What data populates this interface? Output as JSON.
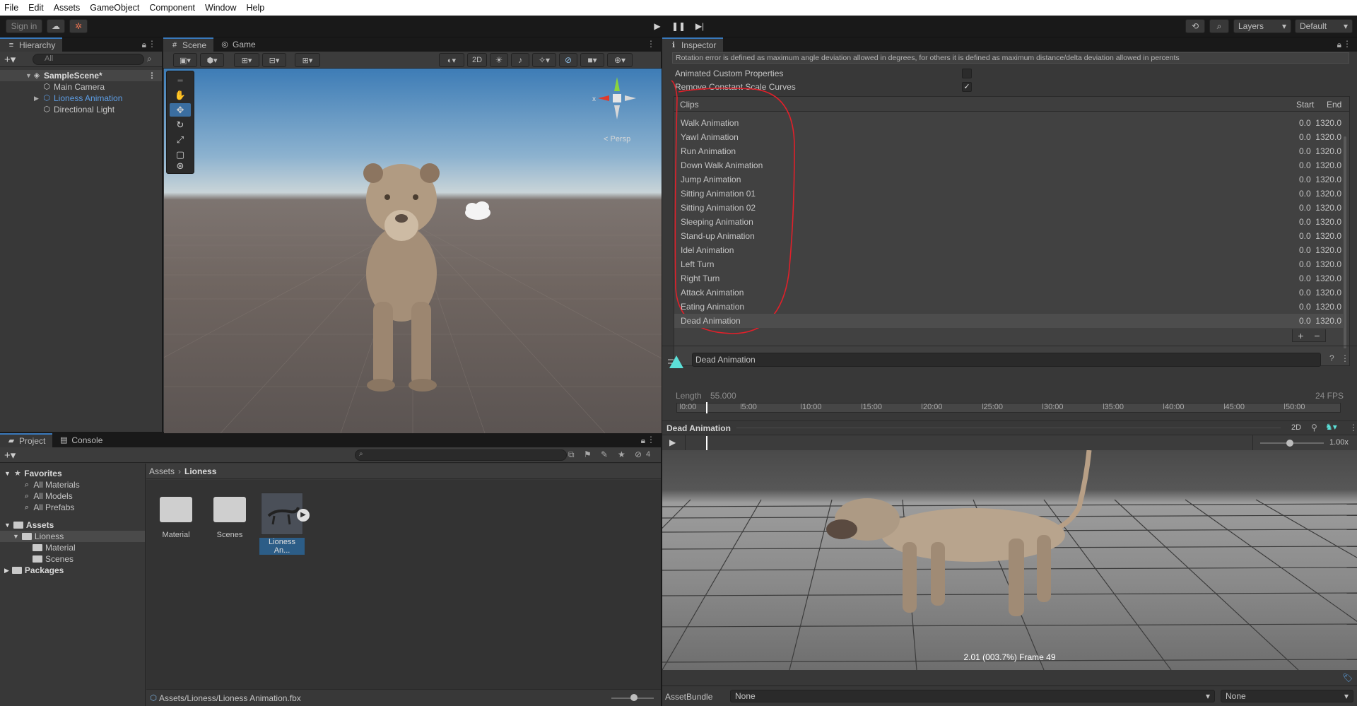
{
  "menu": [
    "File",
    "Edit",
    "Assets",
    "GameObject",
    "Component",
    "Window",
    "Help"
  ],
  "toolbar": {
    "sign_in": "Sign in",
    "layers": "Layers",
    "layout": "Default"
  },
  "hierarchy": {
    "tab": "Hierarchy",
    "search_placeholder": "All",
    "scene": "SampleScene*",
    "items": [
      "Main Camera",
      "Lioness Animation",
      "Directional Light"
    ]
  },
  "scene_panel": {
    "tabs": [
      "Scene",
      "Game"
    ],
    "mode_2d": "2D",
    "persp": "< Persp",
    "gizmo_x": "x"
  },
  "inspector": {
    "tab": "Inspector",
    "hint": "Rotation error is defined as maximum angle deviation allowed in degrees, for others it is defined as maximum distance/delta deviation allowed in percents",
    "prop1": "Animated Custom Properties",
    "prop2": "Remove Constant Scale Curves",
    "clips_header": "Clips",
    "col_start": "Start",
    "col_end": "End",
    "clips": [
      {
        "name": "Walk Animation",
        "values": "0.0  1320.0"
      },
      {
        "name": "YawI Animation",
        "values": "0.0  1320.0"
      },
      {
        "name": "Run Animation",
        "values": "0.0  1320.0"
      },
      {
        "name": "Down Walk Animation",
        "values": "0.0  1320.0"
      },
      {
        "name": "Jump Animation",
        "values": "0.0  1320.0"
      },
      {
        "name": "Sitting Animation 01",
        "values": "0.0  1320.0"
      },
      {
        "name": "Sitting Animation 02",
        "values": "0.0  1320.0"
      },
      {
        "name": "Sleeping Animation",
        "values": "0.0  1320.0"
      },
      {
        "name": "Stand-up Animation",
        "values": "0.0  1320.0"
      },
      {
        "name": "Idel Animation",
        "values": "0.0  1320.0"
      },
      {
        "name": "Left Turn",
        "values": "0.0  1320.0"
      },
      {
        "name": "Right Turn",
        "values": "0.0  1320.0"
      },
      {
        "name": "Attack Animation",
        "values": "0.0  1320.0"
      },
      {
        "name": "Eating Animation",
        "values": "0.0  1320.0"
      },
      {
        "name": "Dead Animation",
        "values": "0.0  1320.0"
      }
    ],
    "plus": "+",
    "minus": "−",
    "clip_name": "Dead Animation",
    "length_label": "Length",
    "length_value": "55.000",
    "fps": "24 FPS",
    "ruler": [
      "0:00",
      "5:00",
      "10:00",
      "15:00",
      "20:00",
      "25:00",
      "30:00",
      "35:00",
      "40:00",
      "45:00",
      "50:00"
    ],
    "preview_title": "Dead Animation",
    "preview_2d": "2D",
    "speed": "1.00x",
    "frame_info": "2.01 (003.7%) Frame 49",
    "asset_bundle_label": "AssetBundle",
    "asset_bundle_value": "None",
    "variant_value": "None"
  },
  "project": {
    "tabs": [
      "Project",
      "Console"
    ],
    "favorites": "Favorites",
    "fav_items": [
      "All Materials",
      "All Models",
      "All Prefabs"
    ],
    "assets": "Assets",
    "tree": [
      "Lioness",
      "Material",
      "Scenes"
    ],
    "packages": "Packages",
    "breadcrumb": [
      "Assets",
      "Lioness"
    ],
    "grid": [
      "Material",
      "Scenes",
      "Lioness An..."
    ],
    "hidden_count": "4",
    "path": "Assets/Lioness/Lioness Animation.fbx"
  },
  "colors": {
    "accent": "#3a79bb",
    "selection": "#2c5d87",
    "link": "#4c8fd6",
    "annotation": "#e0202a"
  }
}
